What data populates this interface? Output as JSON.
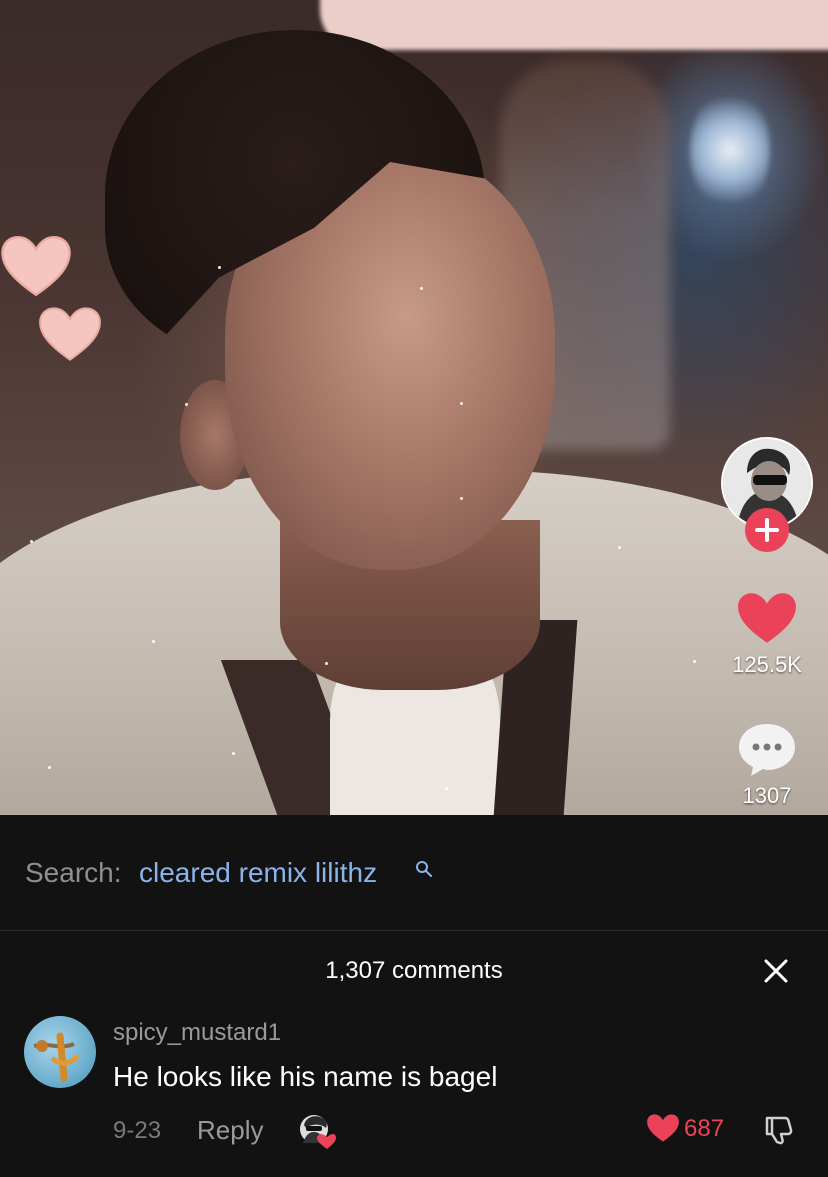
{
  "video": {
    "likes": "125.5K",
    "comments": "1307"
  },
  "search": {
    "prefix": "Search:",
    "query": "cleared remix lilithz"
  },
  "comments_panel": {
    "title": "1,307 comments",
    "items": [
      {
        "username": "spicy_mustard1",
        "text": "He looks like his name is bagel",
        "date": "9-23",
        "reply_label": "Reply",
        "likes": "687"
      }
    ]
  },
  "icons": {
    "like": "heart-icon",
    "comment": "speech-bubble-icon",
    "search": "magnifier-icon",
    "close": "x-icon",
    "dislike": "thumbs-down-icon",
    "follow": "plus-icon"
  },
  "colors": {
    "accent": "#ea4359",
    "link": "#8ab4e8",
    "background": "#121212"
  }
}
